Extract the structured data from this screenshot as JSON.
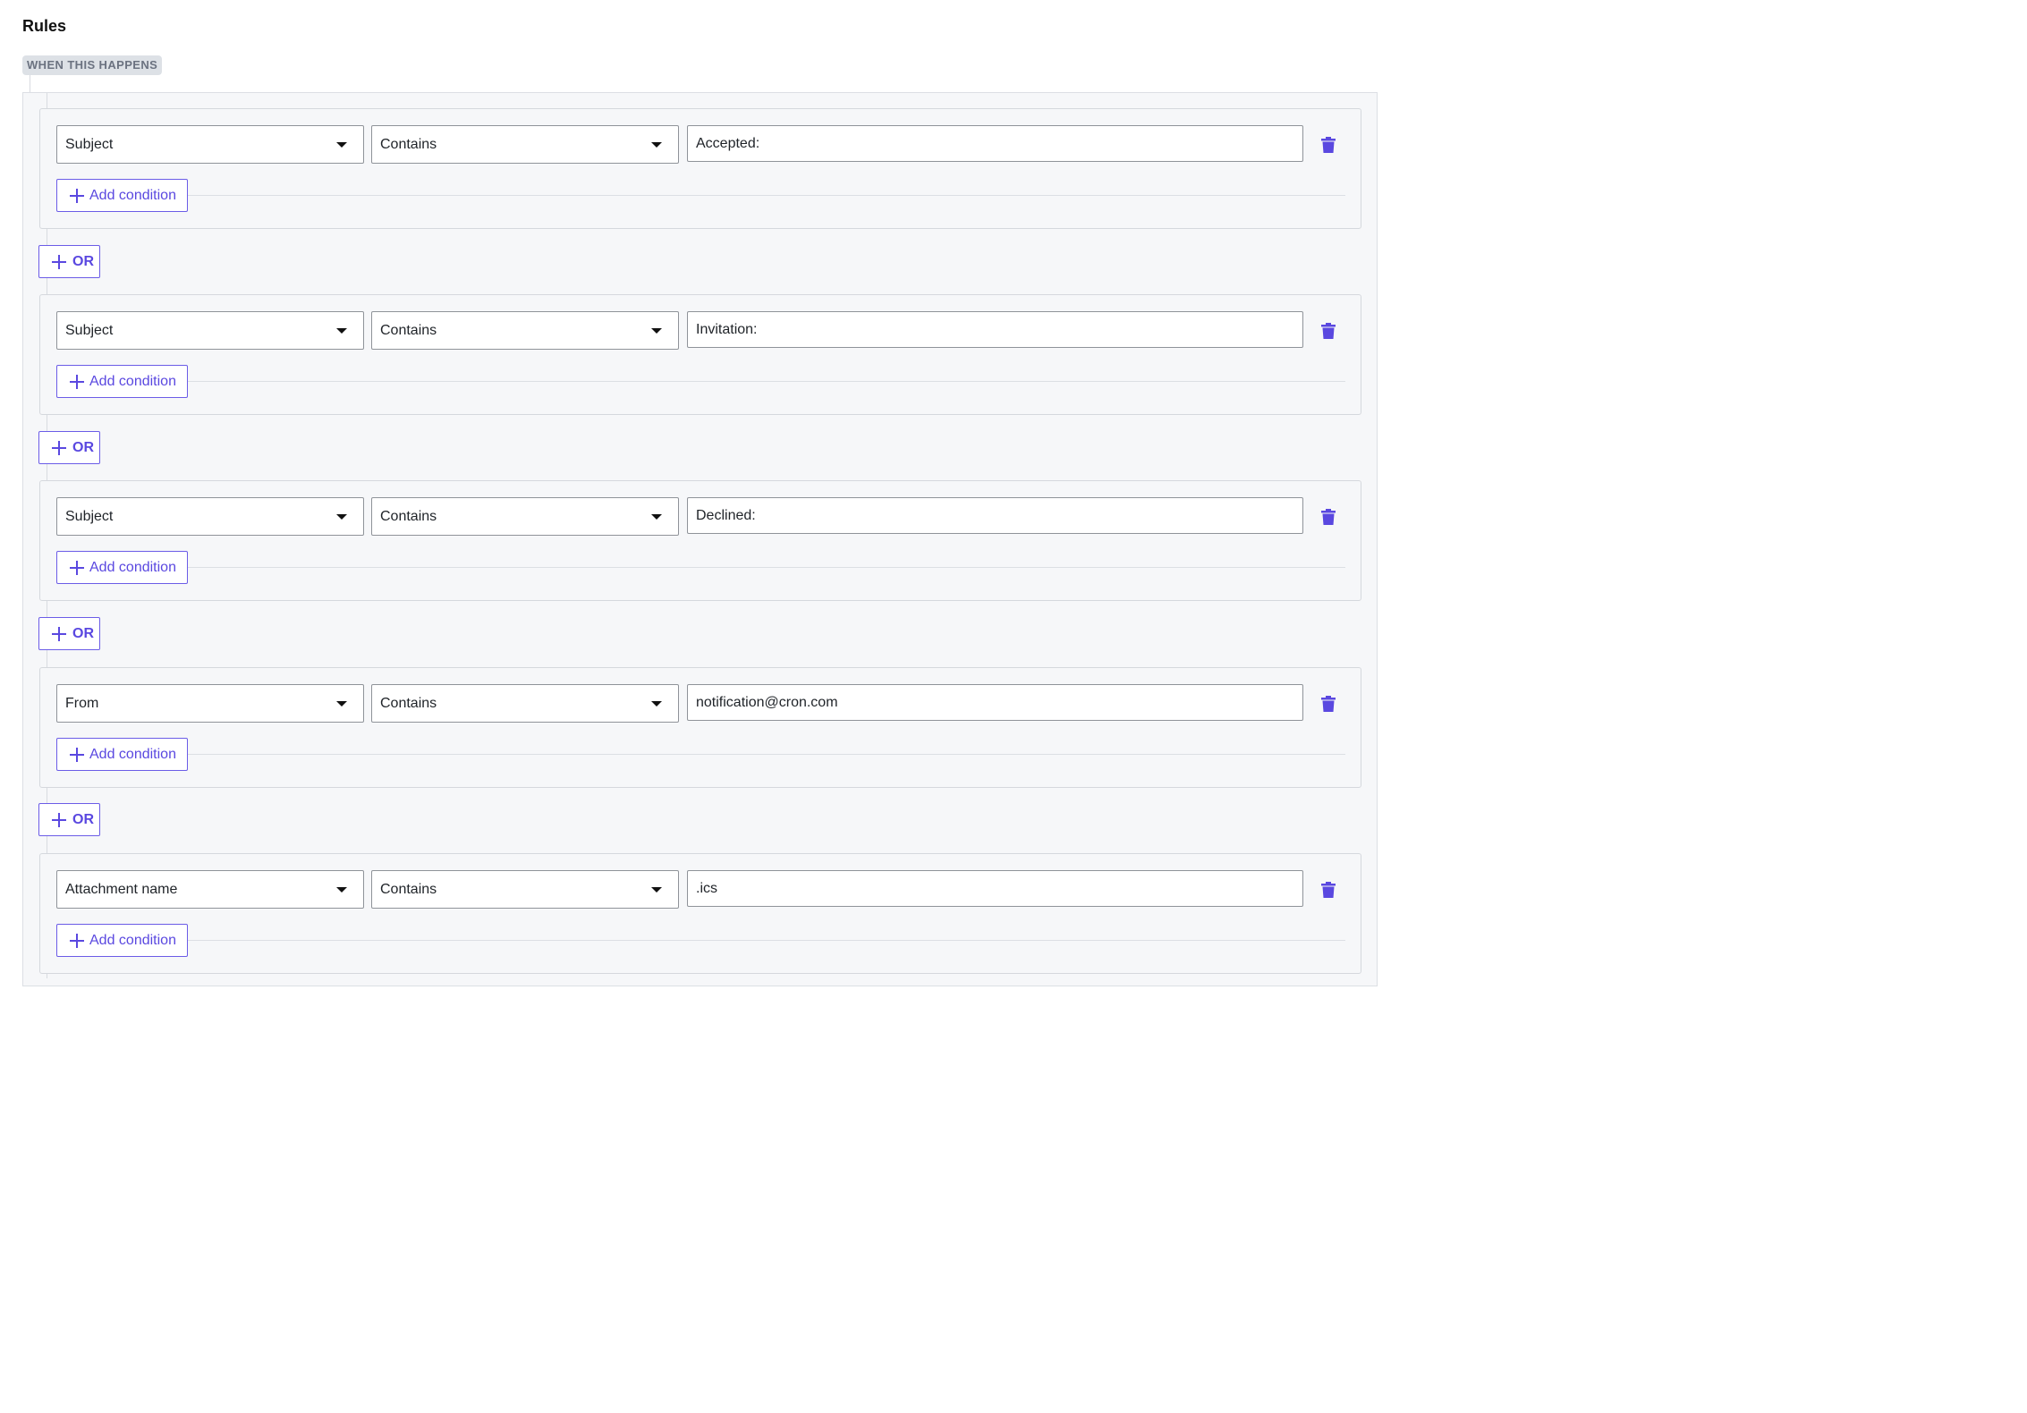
{
  "title": "Rules",
  "section_badge": "WHEN THIS HAPPENS",
  "colors": {
    "accent": "#5a48e0",
    "panel_bg": "#f6f7f9",
    "border": "#8f9399"
  },
  "groups": [
    {
      "field": "Subject",
      "operator": "Contains",
      "value": "Accepted:",
      "add_condition": "Add condition"
    },
    {
      "field": "Subject",
      "operator": "Contains",
      "value": "Invitation:",
      "add_condition": "Add condition"
    },
    {
      "field": "Subject",
      "operator": "Contains",
      "value": "Declined:",
      "add_condition": "Add condition"
    },
    {
      "field": "From",
      "operator": "Contains",
      "value": "notification@cron.com",
      "add_condition": "Add condition"
    },
    {
      "field": "Attachment name",
      "operator": "Contains",
      "value": ".ics",
      "add_condition": "Add condition"
    }
  ],
  "or_buttons": [
    {
      "label": "OR",
      "icon": "plus-icon"
    },
    {
      "label": "OR",
      "icon": "plus-icon"
    },
    {
      "label": "OR",
      "icon": "plus-icon"
    },
    {
      "label": "OR",
      "icon": "plus-icon"
    }
  ],
  "icons": {
    "delete": "trash-icon",
    "add": "plus-icon",
    "dropdown": "chevron-down-icon"
  }
}
